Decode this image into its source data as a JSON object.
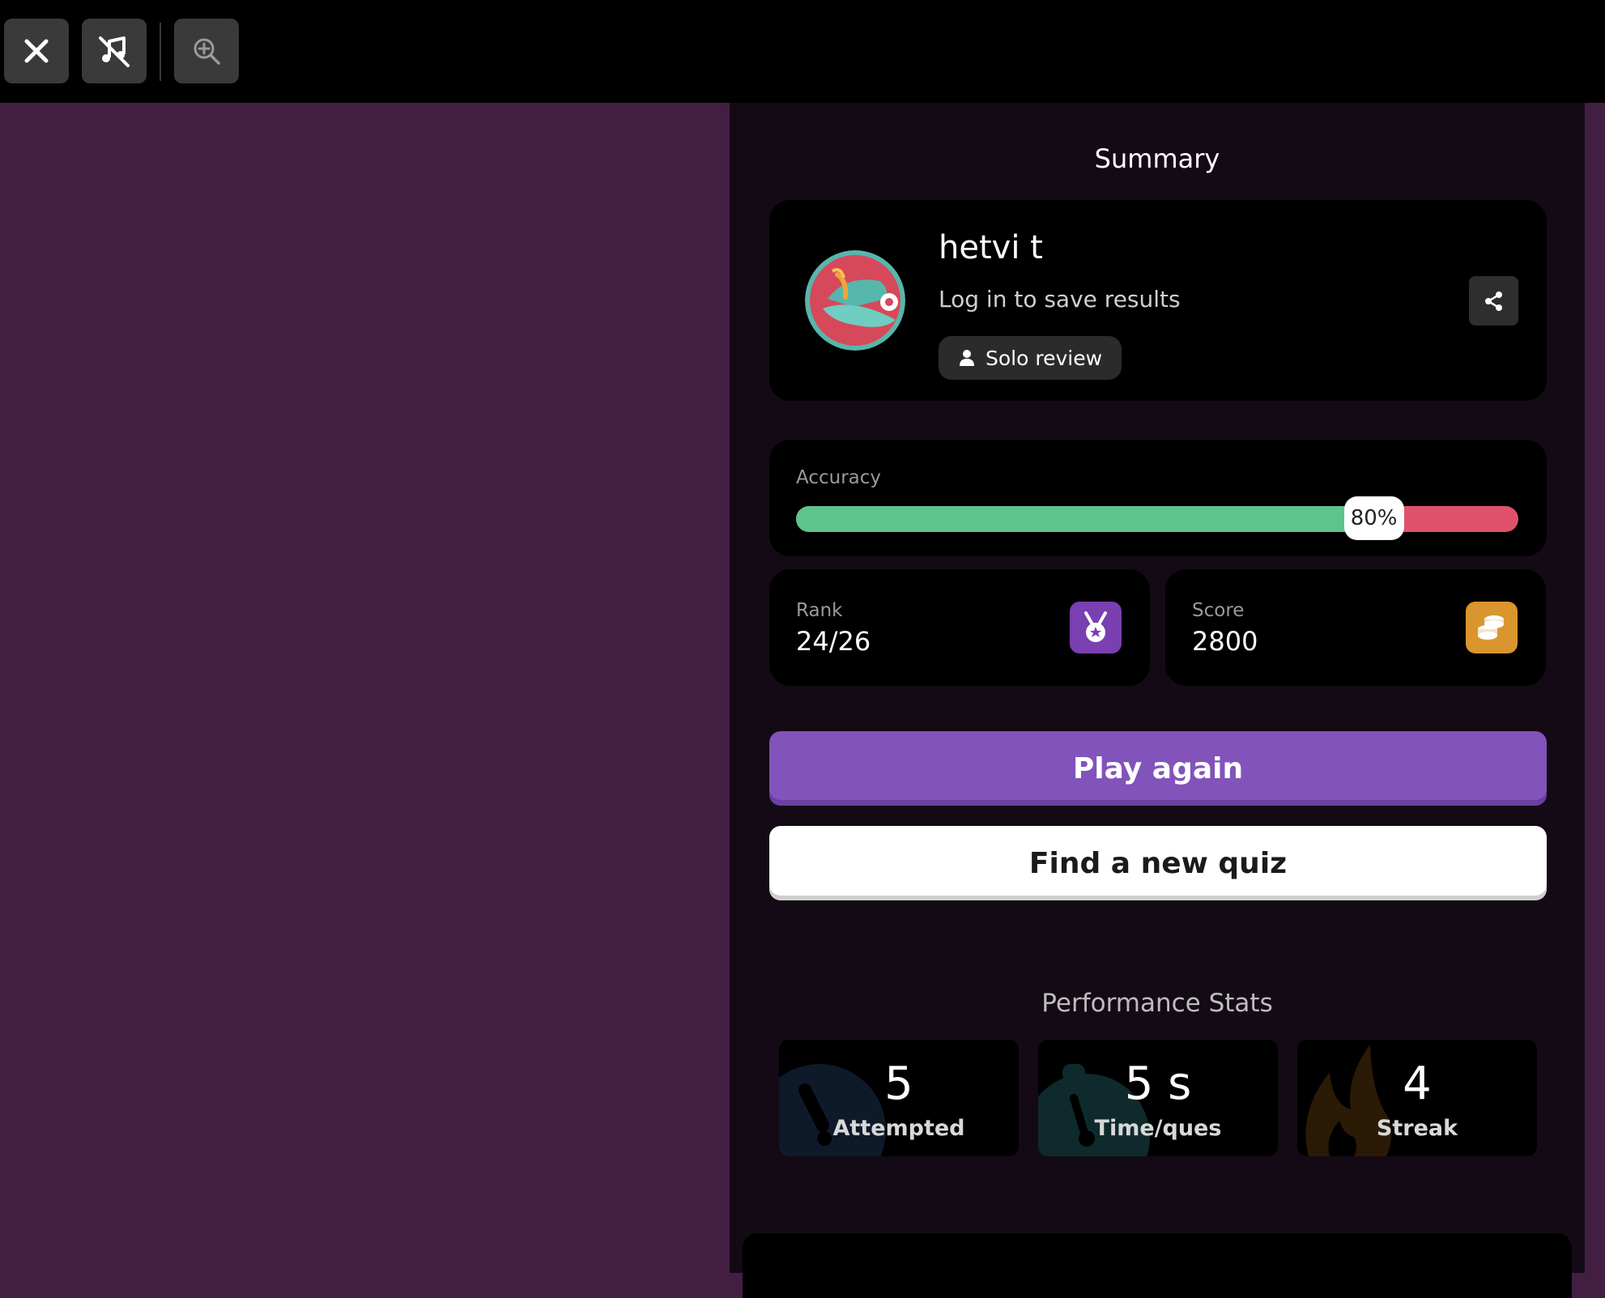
{
  "toolbar": {
    "close_icon": "close-icon",
    "music_off_icon": "music-off-icon",
    "zoom_icon": "zoom-in-icon"
  },
  "summary": {
    "title": "Summary",
    "username": "hetvi t",
    "login_text": "Log in to save results",
    "mode_label": "Solo review"
  },
  "accuracy": {
    "label": "Accuracy",
    "percent_text": "80%",
    "fraction": 0.8
  },
  "rank": {
    "label": "Rank",
    "value": "24/26"
  },
  "score": {
    "label": "Score",
    "value": "2800"
  },
  "buttons": {
    "play_again": "Play again",
    "find_quiz": "Find a new quiz"
  },
  "performance": {
    "title": "Performance Stats",
    "attempted": {
      "value": "5",
      "label": "Attempted"
    },
    "time": {
      "value": "5 s",
      "label": "Time/ques"
    },
    "streak": {
      "value": "4",
      "label": "Streak"
    }
  },
  "colors": {
    "accent": "#8253ba",
    "correct": "#5dc48c",
    "incorrect": "#e0526b",
    "rank_icon_bg": "#7a3fb0",
    "score_icon_bg": "#d9962e"
  }
}
